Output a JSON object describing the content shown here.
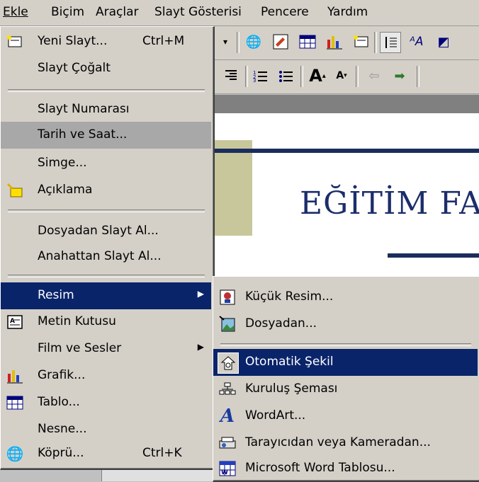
{
  "menubar": {
    "items": [
      "Ekle",
      "Biçim",
      "Araçlar",
      "Slayt Gösterisi",
      "Pencere",
      "Yardım"
    ]
  },
  "slide": {
    "title": "EĞİTİM FA"
  },
  "insert_menu": {
    "items": [
      {
        "label": "Yeni Slayt...",
        "shortcut": "Ctrl+M",
        "icon": "new-slide-icon"
      },
      {
        "label": "Slayt Çoğalt"
      },
      {
        "label": "Slayt Numarası"
      },
      {
        "label": "Tarih ve Saat..."
      },
      {
        "label": "Simge..."
      },
      {
        "label": "Açıklama",
        "icon": "comment-icon"
      },
      {
        "label": "Dosyadan Slayt Al..."
      },
      {
        "label": "Anahattan Slayt Al..."
      },
      {
        "label": "Resim",
        "submenu": true,
        "highlighted": true
      },
      {
        "label": "Metin Kutusu",
        "icon": "text-box-icon"
      },
      {
        "label": "Film ve Sesler",
        "submenu": true
      },
      {
        "label": "Grafik...",
        "icon": "chart-icon"
      },
      {
        "label": "Tablo...",
        "icon": "table-icon"
      },
      {
        "label": "Nesne..."
      },
      {
        "label": "Köprü...",
        "shortcut": "Ctrl+K",
        "icon": "hyperlink-icon"
      }
    ]
  },
  "picture_submenu": {
    "items": [
      {
        "label": "Küçük Resim...",
        "icon": "clip-art-icon"
      },
      {
        "label": "Dosyadan...",
        "icon": "picture-file-icon"
      },
      {
        "label": "Otomatik Şekil",
        "icon": "autoshape-icon",
        "highlighted": true
      },
      {
        "label": "Kuruluş Şeması",
        "icon": "org-chart-icon"
      },
      {
        "label": "WordArt...",
        "icon": "wordart-icon"
      },
      {
        "label": "Tarayıcıdan veya Kameradan...",
        "icon": "scanner-icon"
      },
      {
        "label": "Microsoft Word Tablosu...",
        "icon": "word-table-icon"
      }
    ]
  },
  "colors": {
    "highlight": "#0a246a",
    "menu_bg": "#d4d0c8",
    "slide_title": "#1b2d6b",
    "accent_tan": "#c8c79b"
  }
}
